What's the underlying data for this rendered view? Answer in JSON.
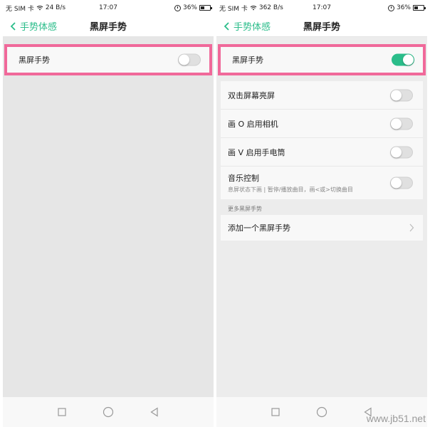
{
  "left": {
    "status": {
      "carrier": "无 SIM 卡",
      "speed": "24 B/s",
      "time": "17:07",
      "battery": "36%"
    },
    "nav": {
      "back_label": "手势体感",
      "title": "黑屏手势"
    },
    "main_toggle": {
      "label": "黑屏手势",
      "on": false
    }
  },
  "right": {
    "status": {
      "carrier": "无 SIM 卡",
      "speed": "362 B/s",
      "time": "17:07",
      "battery": "36%"
    },
    "nav": {
      "back_label": "手势体感",
      "title": "黑屏手势"
    },
    "main_toggle": {
      "label": "黑屏手势",
      "on": true
    },
    "gestures": [
      {
        "label": "双击屏幕亮屏",
        "on": false
      },
      {
        "label": "画 O 启用相机",
        "on": false
      },
      {
        "label": "画 V 启用手电筒",
        "on": false
      },
      {
        "label": "音乐控制",
        "sub": "息屏状态下画 | 暂停/播放曲目，画<或>切换曲目",
        "on": false
      }
    ],
    "more_section": {
      "header": "更多黑屏手势",
      "add_label": "添加一个黑屏手势"
    }
  },
  "colors": {
    "accent": "#2bbd8a",
    "highlight": "#f0699a"
  },
  "watermark": "www.jb51.net"
}
